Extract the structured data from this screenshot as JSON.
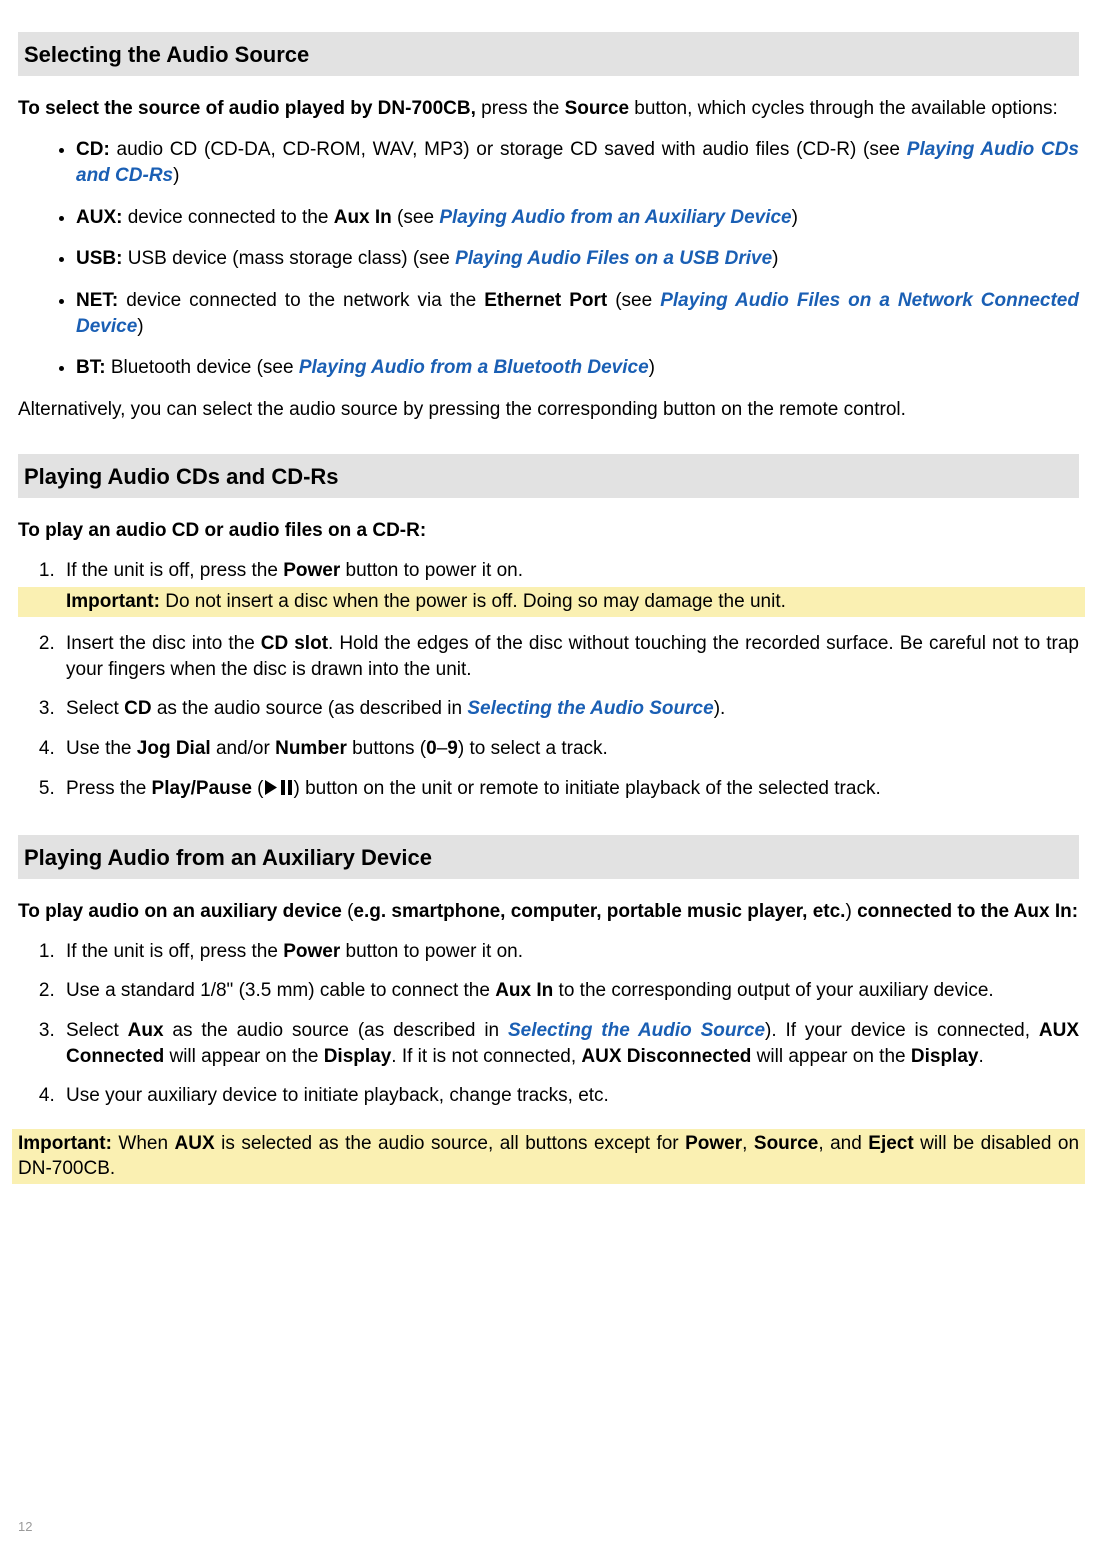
{
  "section1": {
    "title": "Selecting the Audio Source",
    "intro_pre": "To select the source of audio played by DN-700CB,",
    "intro_mid": " press the ",
    "intro_btn": "Source",
    "intro_post": " button, which cycles through the available options:",
    "bullets": {
      "cd_label": "CD:",
      "cd_text": " audio CD (CD-DA, CD-ROM, WAV, MP3) or storage CD saved with audio files (CD-R) (see ",
      "cd_link": "Playing Audio CDs and CD-Rs",
      "cd_end": ")",
      "aux_label": "AUX:",
      "aux_text": " device connected to the ",
      "aux_bold": "Aux In",
      "aux_text2": " (see ",
      "aux_link": "Playing Audio from an Auxiliary Device",
      "aux_end": ")",
      "usb_label": "USB:",
      "usb_text": " USB device (mass storage class) (see ",
      "usb_link": "Playing Audio Files on a USB Drive",
      "usb_end": ")",
      "net_label": "NET:",
      "net_text": " device connected to the network via the ",
      "net_bold": "Ethernet Port",
      "net_text2": " (see ",
      "net_link": "Playing Audio Files on a Network Connected Device",
      "net_end": ")",
      "bt_label": "BT:",
      "bt_text": " Bluetooth device (see ",
      "bt_link": "Playing Audio from a Bluetooth Device",
      "bt_end": ")"
    },
    "alt": "Alternatively, you can select the audio source by pressing the corresponding button on the remote control."
  },
  "section2": {
    "title": "Playing Audio CDs and CD-Rs",
    "intro": "To play an audio CD or audio files on a CD-R:",
    "s1a": "If the unit is off, press the ",
    "s1b": "Power",
    "s1c": " button to power it on.",
    "imp_label": "Important:",
    "imp_text": " Do not insert a disc when the power is off. Doing so may damage the unit.",
    "s2a": "Insert the disc into the ",
    "s2b": "CD slot",
    "s2c": ". Hold the edges of the disc without touching the recorded surface. Be careful not to trap your fingers when the disc is drawn into the unit.",
    "s3a": "Select ",
    "s3b": "CD",
    "s3c": " as the audio source (as described in ",
    "s3link": "Selecting the Audio Source",
    "s3d": ").",
    "s4a": "Use the ",
    "s4b": "Jog Dial",
    "s4c": " and/or ",
    "s4d": "Number",
    "s4e": " buttons (",
    "s4f": "0",
    "s4g": "–",
    "s4h": "9",
    "s4i": ") to select a track.",
    "s5a": "Press the ",
    "s5b": "Play/Pause",
    "s5c": " (",
    "s5d": ") button on the unit or remote to initiate playback of the selected track."
  },
  "section3": {
    "title": "Playing Audio from an Auxiliary Device",
    "intro_pre": "To play audio on an auxiliary device",
    "intro_mid": " (",
    "intro_eg": "e.g. smartphone, computer, portable music player, etc.",
    "intro_post": ") ",
    "intro_end": "connected to the Aux In:",
    "s1a": "If the unit is off, press the ",
    "s1b": "Power",
    "s1c": " button to power it on.",
    "s2a": "Use a standard 1/8\" (3.5 mm) cable to connect the ",
    "s2b": "Aux In",
    "s2c": " to the corresponding output of your auxiliary device.",
    "s3a": "Select ",
    "s3b": "Aux",
    "s3c": " as the audio source (as described in ",
    "s3link": "Selecting the Audio Source",
    "s3d": "). If your device is connected, ",
    "s3e": "AUX Connected",
    "s3f": " will appear on the ",
    "s3g": "Display",
    "s3h": ". If it is not connected, ",
    "s3i": "AUX Disconnected",
    "s3j": " will appear on the ",
    "s3k": "Display",
    "s3l": ".",
    "s4": "Use your auxiliary device to initiate playback, change tracks, etc.",
    "imp_label": "Important:",
    "imp_a": " When ",
    "imp_b": "AUX",
    "imp_c": " is selected as the audio source, all buttons except for ",
    "imp_d": "Power",
    "imp_e": ", ",
    "imp_f": "Source",
    "imp_g": ", and ",
    "imp_h": "Eject",
    "imp_i": " will be disabled on DN-700CB."
  },
  "page_number": "12"
}
